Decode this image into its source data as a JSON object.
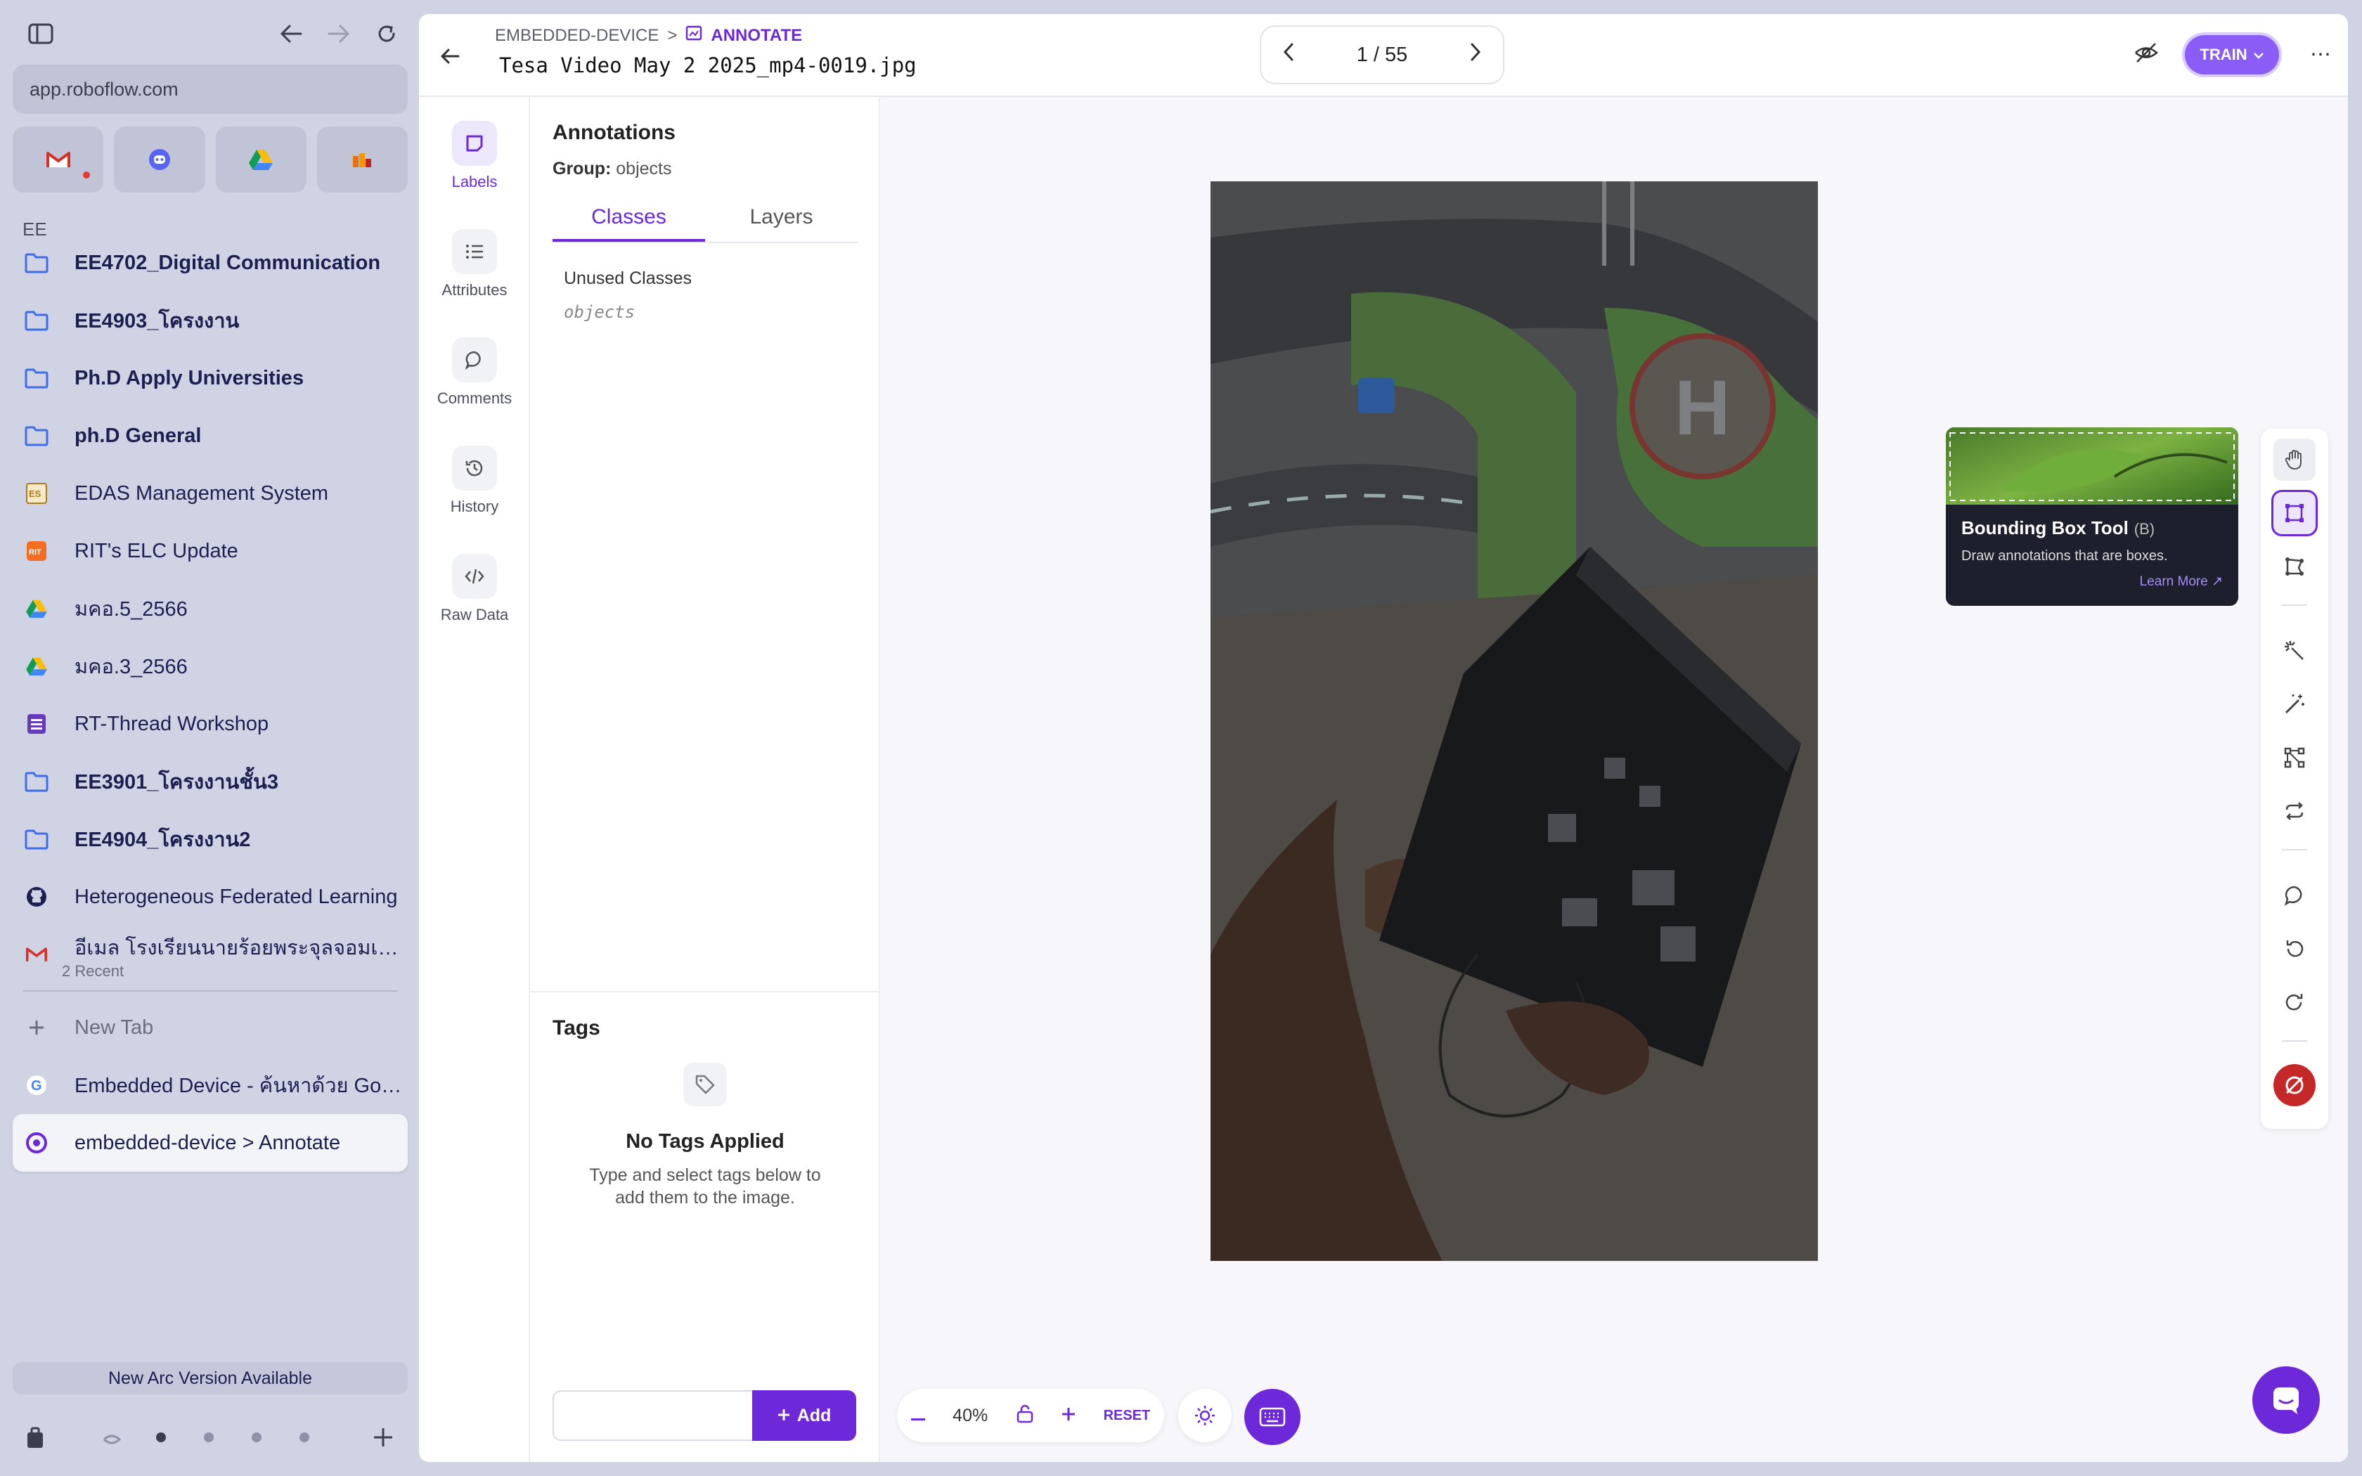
{
  "browser": {
    "url": "app.roboflow.com",
    "space_label": "EE",
    "tabs": [
      {
        "label": "EE4702_Digital Communication",
        "icon": "folder-icon",
        "bold": true
      },
      {
        "label": "EE4903_โครงงาน",
        "icon": "folder-icon",
        "bold": true
      },
      {
        "label": "Ph.D Apply Universities",
        "icon": "folder-icon",
        "bold": true
      },
      {
        "label": "ph.D General",
        "icon": "folder-icon",
        "bold": true
      },
      {
        "label": "EDAS Management System",
        "icon": "edas-icon",
        "bold": false
      },
      {
        "label": "RIT's ELC Update",
        "icon": "rit-icon",
        "bold": false
      },
      {
        "label": "มคอ.5_2566",
        "icon": "drive-icon",
        "bold": false
      },
      {
        "label": "มคอ.3_2566",
        "icon": "drive-icon",
        "bold": false
      },
      {
        "label": "RT-Thread Workshop",
        "icon": "form-icon",
        "bold": false
      },
      {
        "label": "EE3901_โครงงานชั้น3",
        "icon": "folder-icon",
        "bold": true
      },
      {
        "label": "EE4904_โครงงาน2",
        "icon": "folder-icon",
        "bold": true
      },
      {
        "label": "Heterogeneous Federated Learning",
        "icon": "github-icon",
        "bold": false
      },
      {
        "label": "อีเมล โรงเรียนนายร้อยพระจุลจอมเกล้า",
        "icon": "gmail-icon",
        "bold": false,
        "sub": "2 Recent"
      }
    ],
    "new_tab": "New Tab",
    "open_tabs": [
      {
        "label": "Embedded Device - ค้นหาด้วย Goo...",
        "icon": "google-icon"
      },
      {
        "label": "embedded-device > Annotate",
        "icon": "roboflow-icon",
        "active": true
      }
    ],
    "update_banner": "New Arc Version Available"
  },
  "app": {
    "breadcrumb": {
      "project": "EMBEDDED-DEVICE",
      "separator": ">",
      "current": "ANNOTATE"
    },
    "filename": "Tesa Video May 2 2025_mp4-0019.jpg",
    "pager": "1 / 55",
    "train_label": "TRAIN",
    "rail": [
      {
        "label": "Labels",
        "icon": "label-icon",
        "selected": true
      },
      {
        "label": "Attributes",
        "icon": "list-icon"
      },
      {
        "label": "Comments",
        "icon": "comment-icon"
      },
      {
        "label": "History",
        "icon": "history-icon"
      },
      {
        "label": "Raw Data",
        "icon": "code-icon"
      }
    ],
    "panel": {
      "title": "Annotations",
      "group_label": "Group:",
      "group_value": "objects",
      "tabs": [
        "Classes",
        "Layers"
      ],
      "unused_title": "Unused Classes",
      "unused_item": "objects"
    },
    "tags": {
      "title": "Tags",
      "empty_title": "No Tags Applied",
      "empty_sub": "Type and select tags below to add them to the image.",
      "add_label": "Add"
    },
    "tooltip": {
      "title": "Bounding Box Tool",
      "shortcut": "(B)",
      "desc": "Draw annotations that are boxes.",
      "link": "Learn More ↗"
    },
    "zoom": {
      "value": "40%",
      "reset": "RESET"
    }
  }
}
